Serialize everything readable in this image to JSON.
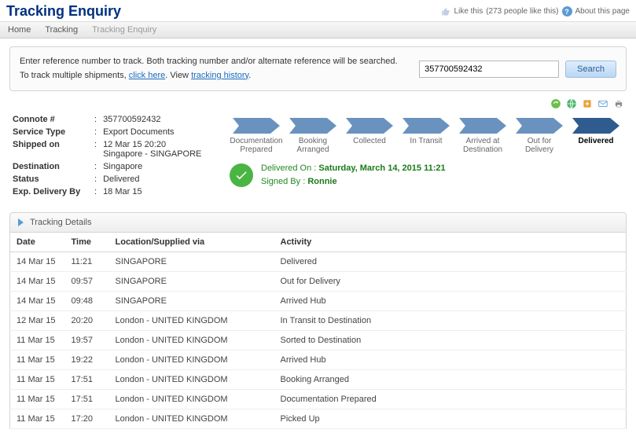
{
  "header": {
    "title": "Tracking Enquiry",
    "like_label": "Like this",
    "like_count_text": "(273 people like this)",
    "about_label": "About this page"
  },
  "breadcrumb": [
    "Home",
    "Tracking",
    "Tracking Enquiry"
  ],
  "search": {
    "line1": "Enter reference number to track. Both tracking number and/or alternate reference will be searched.",
    "line2a": "To track multiple shipments, ",
    "link1": "click here",
    "line2b": ". View ",
    "link2": "tracking history",
    "line2c": ".",
    "input_value": "357700592432",
    "button": "Search"
  },
  "meta": {
    "connote_label": "Connote #",
    "connote": "357700592432",
    "service_label": "Service Type",
    "service": "Export Documents",
    "shipped_label": "Shipped on",
    "shipped": "12 Mar 15 20:20",
    "shipped_from": "Singapore - SINGAPORE",
    "dest_label": "Destination",
    "dest": "Singapore",
    "status_label": "Status",
    "status": "Delivered",
    "expdel_label": "Exp. Delivery By",
    "expdel": "18 Mar 15"
  },
  "steps": [
    "Documentation Prepared",
    "Booking Arranged",
    "Collected",
    "In Transit",
    "Arrived at Destination",
    "Out for Delivery",
    "Delivered"
  ],
  "delivered": {
    "on_label": "Delivered On :",
    "on_value": "Saturday, March 14, 2015 11:21",
    "signed_label": "Signed By :",
    "signed_value": "Ronnie"
  },
  "details": {
    "title": "Tracking Details",
    "columns": [
      "Date",
      "Time",
      "Location/Supplied via",
      "Activity"
    ],
    "rows": [
      [
        "14 Mar 15",
        "11:21",
        "SINGAPORE",
        "Delivered"
      ],
      [
        "14 Mar 15",
        "09:57",
        "SINGAPORE",
        "Out for Delivery"
      ],
      [
        "14 Mar 15",
        "09:48",
        "SINGAPORE",
        "Arrived Hub"
      ],
      [
        "12 Mar 15",
        "20:20",
        "London - UNITED KINGDOM",
        "In Transit to Destination"
      ],
      [
        "11 Mar 15",
        "19:57",
        "London - UNITED KINGDOM",
        "Sorted to Destination"
      ],
      [
        "11 Mar 15",
        "19:22",
        "London - UNITED KINGDOM",
        "Arrived Hub"
      ],
      [
        "11 Mar 15",
        "17:51",
        "London - UNITED KINGDOM",
        "Booking Arranged"
      ],
      [
        "11 Mar 15",
        "17:51",
        "London - UNITED KINGDOM",
        "Documentation Prepared"
      ],
      [
        "11 Mar 15",
        "17:20",
        "London - UNITED KINGDOM",
        "Picked Up"
      ]
    ]
  }
}
